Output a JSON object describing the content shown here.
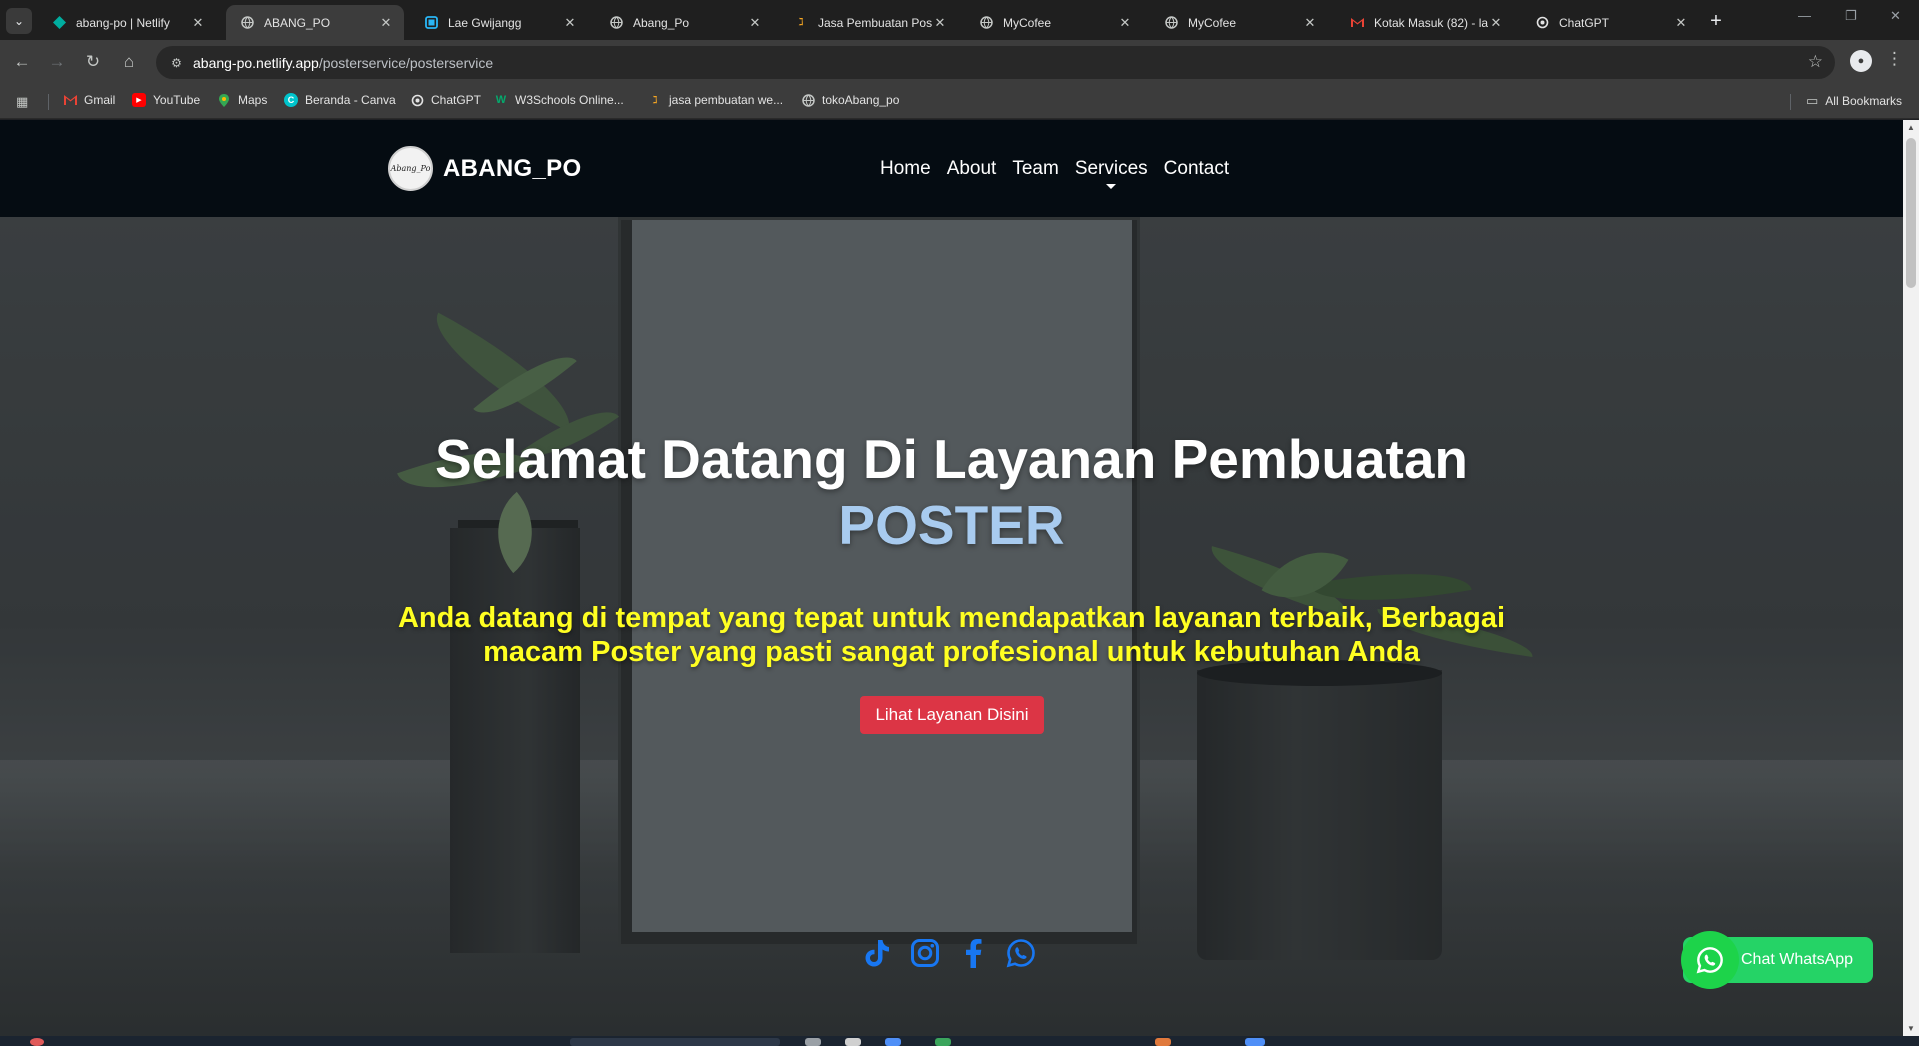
{
  "browser": {
    "tabs": [
      {
        "title": "abang-po | Netlify",
        "icon": "netlify-icon",
        "color": "#00ad9f",
        "active": false
      },
      {
        "title": "ABANG_PO",
        "icon": "globe-icon",
        "color": "#c4c7c5",
        "active": true
      },
      {
        "title": "Lae Gwijangg",
        "icon": "page-icon",
        "color": "#29b6f6",
        "active": false
      },
      {
        "title": "Abang_Po",
        "icon": "globe-icon",
        "color": "#c4c7c5",
        "active": false
      },
      {
        "title": "Jasa Pembuatan Post",
        "icon": "fiverr-icon",
        "color": "#f5a623",
        "active": false
      },
      {
        "title": "MyCofee",
        "icon": "globe-icon",
        "color": "#c4c7c5",
        "active": false
      },
      {
        "title": "MyCofee",
        "icon": "globe-icon",
        "color": "#c4c7c5",
        "active": false
      },
      {
        "title": "Kotak Masuk (82) - la",
        "icon": "gmail-icon",
        "color": "#ea4335",
        "active": false
      },
      {
        "title": "ChatGPT",
        "icon": "chatgpt-icon",
        "color": "#e3e3e3",
        "active": false
      }
    ],
    "url": {
      "host": "abang-po.netlify.app",
      "path": "/posterservice/posterservice"
    },
    "bookmarks": [
      {
        "label": "Gmail",
        "icon": "gmail-icon",
        "color": "#ea4335"
      },
      {
        "label": "YouTube",
        "icon": "youtube-icon",
        "color": "#ff0000"
      },
      {
        "label": "Maps",
        "icon": "maps-icon",
        "color": "#34a853"
      },
      {
        "label": "Beranda - Canva",
        "icon": "canva-icon",
        "color": "#00c4cc"
      },
      {
        "label": "ChatGPT",
        "icon": "chatgpt-icon",
        "color": "#e3e3e3"
      },
      {
        "label": "W3Schools Online...",
        "icon": "w3schools-icon",
        "color": "#04aa6d"
      },
      {
        "label": "jasa pembuatan we...",
        "icon": "fiverr-icon",
        "color": "#f5a623"
      },
      {
        "label": "tokoAbang_po",
        "icon": "globe-icon",
        "color": "#c4c7c5"
      }
    ],
    "all_bookmarks_label": "All Bookmarks"
  },
  "site": {
    "brand": "ABANG_PO",
    "logo_text": "Abang_Po",
    "nav": [
      "Home",
      "About",
      "Team",
      "Services",
      "Contact"
    ],
    "hero": {
      "title": "Selamat Datang Di Layanan Pembuatan",
      "title_accent": "POSTER",
      "subtitle": "Anda datang di tempat yang tepat untuk mendapatkan layanan terbaik, Berbagai macam Poster yang pasti sangat profesional untuk kebutuhan Anda",
      "cta": "Lihat Layanan Disini"
    },
    "socials": [
      "tiktok-icon",
      "instagram-icon",
      "facebook-icon",
      "whatsapp-icon"
    ],
    "whatsapp_button": "Chat WhatsApp",
    "colors": {
      "accent_title": "#a8cbef",
      "subtitle": "#ffff22",
      "cta": "#dc3545",
      "social": "#1877f2",
      "whatsapp": "#25d366",
      "nav_bg": "#050c12"
    }
  }
}
